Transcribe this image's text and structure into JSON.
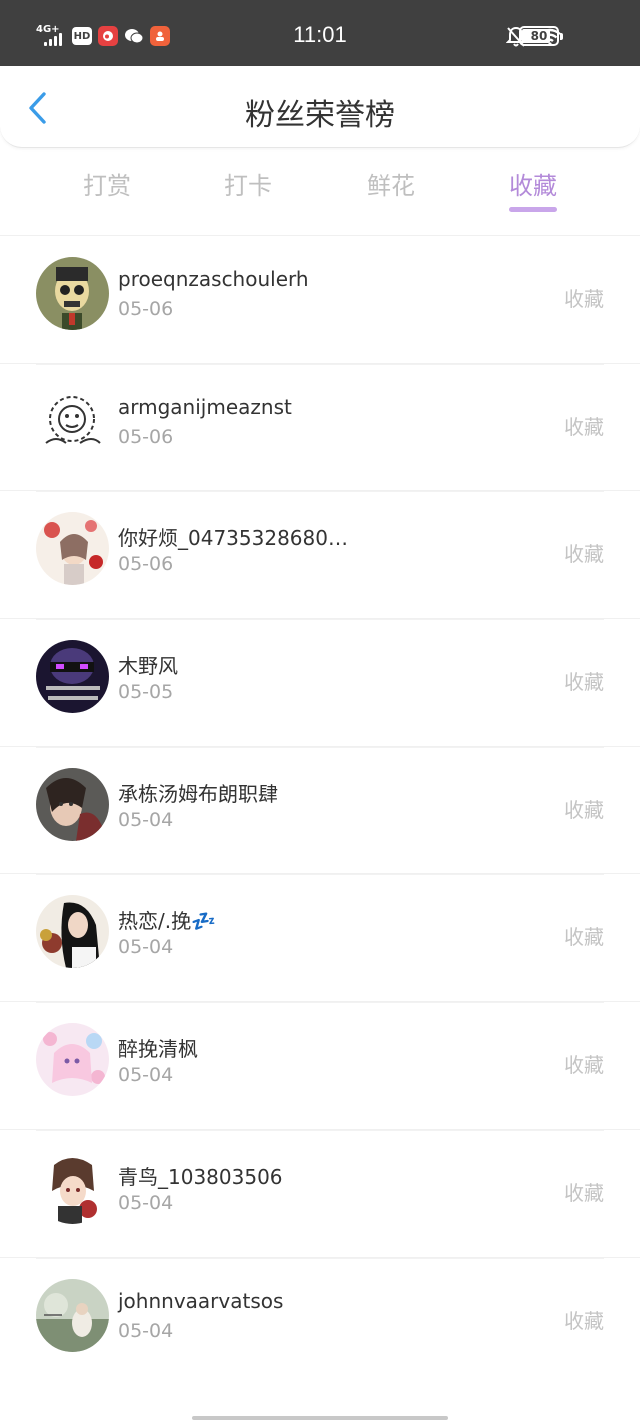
{
  "status_bar": {
    "time": "11:01",
    "network": "4G+",
    "hd": "HD",
    "battery": "80",
    "icons": [
      "signal-icon",
      "hd-icon",
      "weibo-icon",
      "wechat-icon",
      "app-icon",
      "mute-bell-icon",
      "wifi-icon",
      "battery-icon"
    ]
  },
  "header": {
    "title": "粉丝荣誉榜",
    "back_icon": "chevron-left-icon"
  },
  "tabs": [
    {
      "label": "打赏",
      "active": false
    },
    {
      "label": "打卡",
      "active": false
    },
    {
      "label": "鲜花",
      "active": false
    },
    {
      "label": "收藏",
      "active": true
    }
  ],
  "colors": {
    "accent": "#b38ad9",
    "status_bar": "#404040",
    "back_icon": "#3a9ce8"
  },
  "list": [
    {
      "name": "proeqnzaschoulerh",
      "date": "05-06",
      "action": "收藏"
    },
    {
      "name": "armganijmeaznst",
      "date": "05-06",
      "action": "收藏"
    },
    {
      "name": "你好烦_04735328680…",
      "date": "05-06",
      "action": "收藏"
    },
    {
      "name": "木野风",
      "date": "05-05",
      "action": "收藏"
    },
    {
      "name": "承栋汤姆布朗职肆",
      "date": "05-04",
      "action": "收藏"
    },
    {
      "name": "热恋/.挽💤",
      "date": "05-04",
      "action": "收藏"
    },
    {
      "name": "醉挽清枫",
      "date": "05-04",
      "action": "收藏"
    },
    {
      "name": "青鸟_103803506",
      "date": "05-04",
      "action": "收藏"
    },
    {
      "name": "johnnvaarvatsos",
      "date": "05-04",
      "action": "收藏"
    }
  ]
}
